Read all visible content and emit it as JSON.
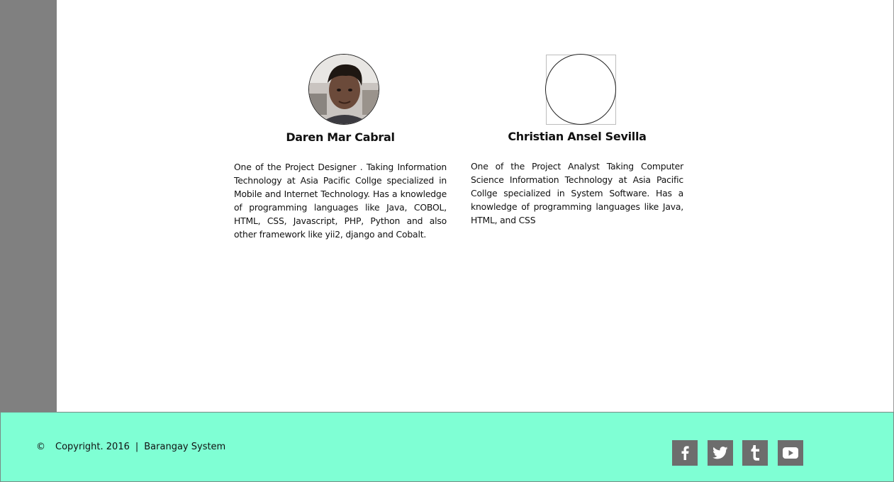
{
  "team": [
    {
      "name": "Daren Mar Cabral",
      "bio": "One of the Project Designer . Taking Information Technology at Asia Pacific Collge specialized in Mobile and Internet Technology. Has a knowledge of programming languages like Java, COBOL, HTML, CSS, Javascript, PHP, Python and also other framework like yii2, django and Cobalt.",
      "avatar": "profile-photo"
    },
    {
      "name": "Christian Ansel Sevilla",
      "bio": "One of the Project Analyst Taking Computer Science Information Technology at Asia Pacific Collge specialized in System Software. Has a knowledge of programming languages like Java, HTML, and CSS",
      "avatar": "broken-image-placeholder"
    }
  ],
  "footer": {
    "copyright_symbol": "©",
    "copyright_text": "Copyright. 2016",
    "separator": "|",
    "site_name": "Barangay System",
    "social_icons": [
      "facebook-icon",
      "twitter-icon",
      "tumblr-icon",
      "youtube-icon"
    ]
  },
  "colors": {
    "sidebar": "#808080",
    "footer_bg": "#7fffd4",
    "social_bg": "#6d6d6d"
  }
}
